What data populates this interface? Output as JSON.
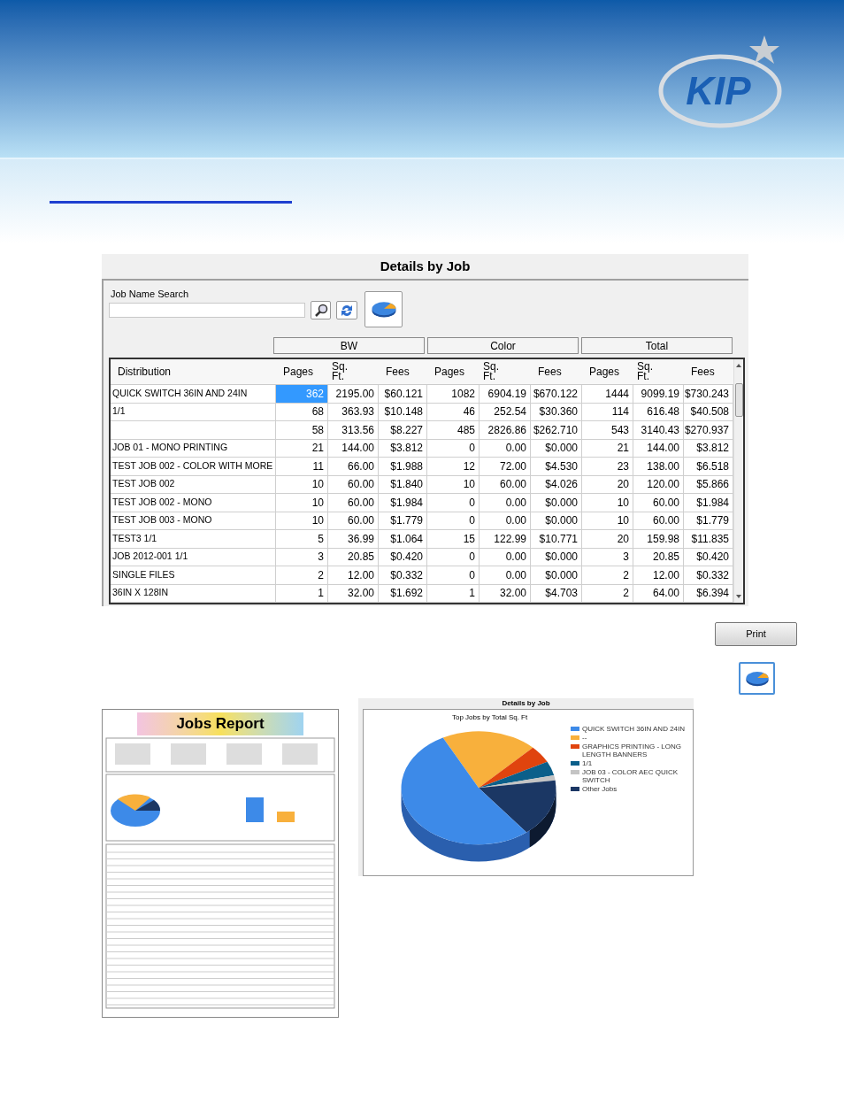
{
  "logo": {
    "text": "KIP"
  },
  "window": {
    "title": "Details by Job"
  },
  "search": {
    "label": "Job Name Search"
  },
  "groups": [
    "BW",
    "Color",
    "Total"
  ],
  "columns": [
    "Distribution",
    "Pages",
    "Sq.\nFt.",
    "Fees",
    "Pages",
    "Sq.\nFt.",
    "Fees",
    "Pages",
    "Sq.\nFt.",
    "Fees"
  ],
  "rows": [
    {
      "distribution": "QUICK SWITCH 36IN AND 24IN",
      "selected": true,
      "values": [
        "362",
        "2195.00",
        "$60.121",
        "1082",
        "6904.19",
        "$670.122",
        "1444",
        "9099.19",
        "$730.243"
      ]
    },
    {
      "distribution": "1/1",
      "selected": false,
      "values": [
        "68",
        "363.93",
        "$10.148",
        "46",
        "252.54",
        "$30.360",
        "114",
        "616.48",
        "$40.508"
      ]
    },
    {
      "distribution": "",
      "selected": false,
      "values": [
        "58",
        "313.56",
        "$8.227",
        "485",
        "2826.86",
        "$262.710",
        "543",
        "3140.43",
        "$270.937"
      ]
    },
    {
      "distribution": "JOB 01 - MONO PRINTING",
      "selected": false,
      "values": [
        "21",
        "144.00",
        "$3.812",
        "0",
        "0.00",
        "$0.000",
        "21",
        "144.00",
        "$3.812"
      ]
    },
    {
      "distribution": "TEST JOB 002 - COLOR WITH MORE",
      "selected": false,
      "values": [
        "11",
        "66.00",
        "$1.988",
        "12",
        "72.00",
        "$4.530",
        "23",
        "138.00",
        "$6.518"
      ]
    },
    {
      "distribution": "TEST JOB 002",
      "selected": false,
      "values": [
        "10",
        "60.00",
        "$1.840",
        "10",
        "60.00",
        "$4.026",
        "20",
        "120.00",
        "$5.866"
      ]
    },
    {
      "distribution": "TEST JOB 002 - MONO",
      "selected": false,
      "values": [
        "10",
        "60.00",
        "$1.984",
        "0",
        "0.00",
        "$0.000",
        "10",
        "60.00",
        "$1.984"
      ]
    },
    {
      "distribution": "TEST JOB 003 - MONO",
      "selected": false,
      "values": [
        "10",
        "60.00",
        "$1.779",
        "0",
        "0.00",
        "$0.000",
        "10",
        "60.00",
        "$1.779"
      ]
    },
    {
      "distribution": "TEST3 1/1",
      "selected": false,
      "values": [
        "5",
        "36.99",
        "$1.064",
        "15",
        "122.99",
        "$10.771",
        "20",
        "159.98",
        "$11.835"
      ]
    },
    {
      "distribution": "JOB 2012-001 1/1",
      "selected": false,
      "values": [
        "3",
        "20.85",
        "$0.420",
        "0",
        "0.00",
        "$0.000",
        "3",
        "20.85",
        "$0.420"
      ]
    },
    {
      "distribution": "SINGLE FILES",
      "selected": false,
      "values": [
        "2",
        "12.00",
        "$0.332",
        "0",
        "0.00",
        "$0.000",
        "2",
        "12.00",
        "$0.332"
      ]
    },
    {
      "distribution": "36IN X 128IN",
      "selected": false,
      "values": [
        "1",
        "32.00",
        "$1.692",
        "1",
        "32.00",
        "$4.703",
        "2",
        "64.00",
        "$6.394"
      ]
    }
  ],
  "print_button": "Print",
  "report_preview": {
    "title": "Jobs Report"
  },
  "chart_panel": {
    "title": "Details by Job",
    "chart_title": "Top Jobs by Total Sq. Ft",
    "legend": [
      {
        "label": "QUICK SWITCH 36IN AND 24IN",
        "color": "#3d8ae8"
      },
      {
        "label": "--",
        "color": "#f8b03c"
      },
      {
        "label": "GRAPHICS PRINTING - LONG LENGTH BANNERS",
        "color": "#e0440e"
      },
      {
        "label": "1/1",
        "color": "#0b5f8a"
      },
      {
        "label": "JOB 03 - COLOR AEC QUICK SWITCH",
        "color": "#c4c4c4"
      },
      {
        "label": "Other Jobs",
        "color": "#1b3764"
      }
    ]
  }
}
